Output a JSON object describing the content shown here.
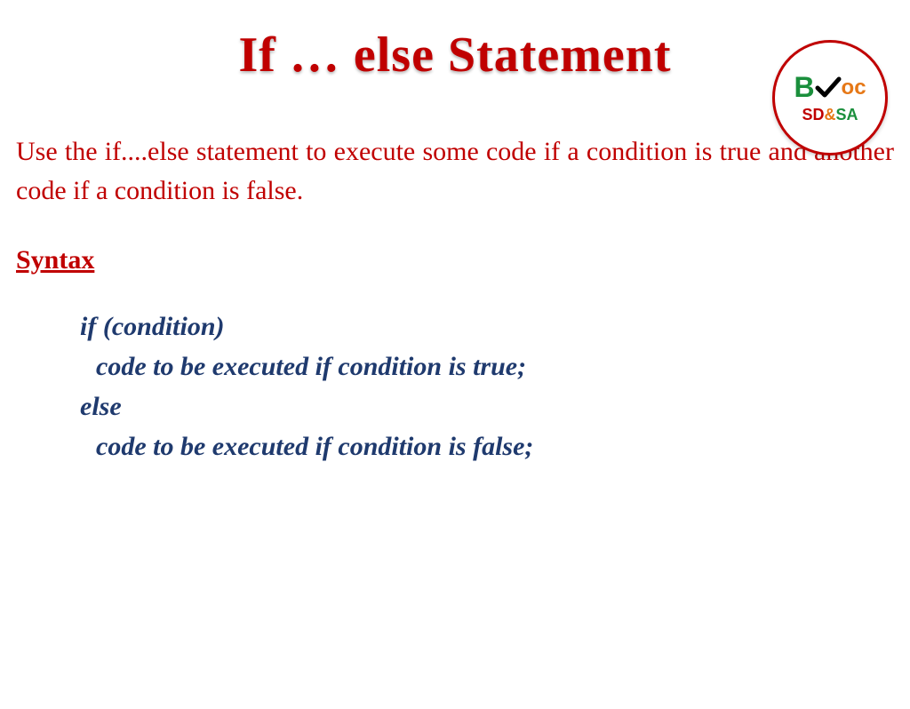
{
  "title": "If … else Statement",
  "logo": {
    "text_b": "B",
    "text_oc": "oc",
    "text_sd": "SD",
    "text_amp": "&",
    "text_sa": "SA"
  },
  "description": "Use the if....else statement to execute some code if a condition is true and another code if a condition is false.",
  "syntax_heading": "Syntax",
  "code": {
    "line1": "if (condition)",
    "line2": "code to be executed if condition is true;",
    "line3": "else",
    "line4": "code to be executed if condition is false;"
  }
}
